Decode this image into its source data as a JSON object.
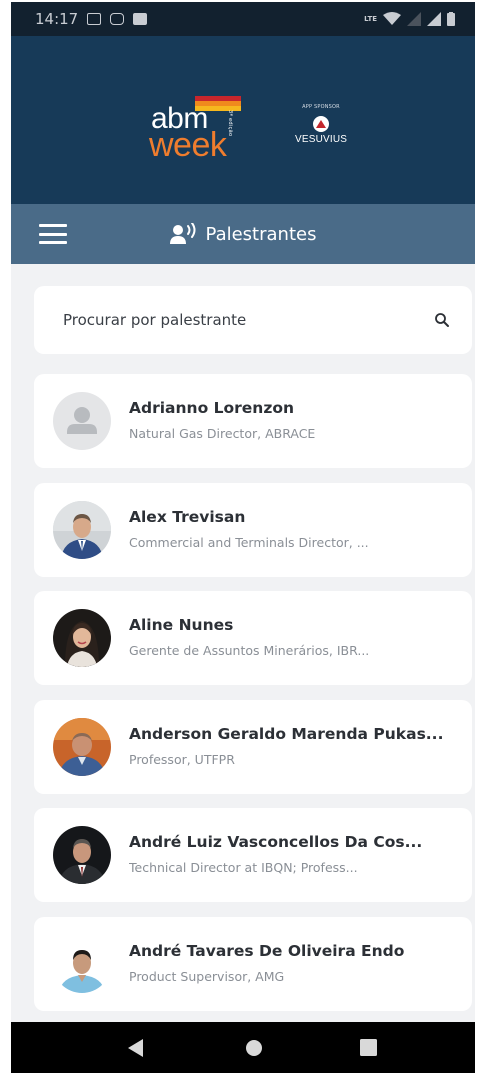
{
  "status_bar": {
    "time": "14:17",
    "network_label": "LTE"
  },
  "banner": {
    "logo_text_top": "abm",
    "logo_text_bottom": "week",
    "logo_edition": "3ª edição",
    "logo_stripe_colors": [
      "#c8262c",
      "#f08a1d",
      "#f6b81e",
      "#ffffff"
    ],
    "sponsor_label": "APP SPONSOR",
    "sponsor_name": "VESUVIUS"
  },
  "nav": {
    "title": "Palestrantes",
    "icon": "speaker-icon"
  },
  "search": {
    "placeholder": "Procurar por palestrante",
    "value": ""
  },
  "speakers": [
    {
      "name": "Adrianno Lorenzon",
      "role": "Natural Gas Director, ABRACE",
      "avatar": "placeholder"
    },
    {
      "name": "Alex Trevisan",
      "role": "Commercial and Terminals Director, ...",
      "avatar": "photo"
    },
    {
      "name": "Aline Nunes",
      "role": "Gerente de Assuntos Minerários, IBR...",
      "avatar": "photo"
    },
    {
      "name": "Anderson Geraldo Marenda Pukas...",
      "role": "Professor, UTFPR",
      "avatar": "photo"
    },
    {
      "name": "André Luiz Vasconcellos Da Cos...",
      "role": "Technical Director at IBQN; Profess...",
      "avatar": "photo"
    },
    {
      "name": "André Tavares De Oliveira Endo",
      "role": "Product Supervisor, AMG",
      "avatar": "photo"
    }
  ],
  "colors": {
    "status_bar": "#12212f",
    "banner": "#173a58",
    "nav_bar": "#4a6b88",
    "background": "#f1f2f4",
    "card": "#ffffff",
    "accent_orange": "#ef7d2e"
  }
}
